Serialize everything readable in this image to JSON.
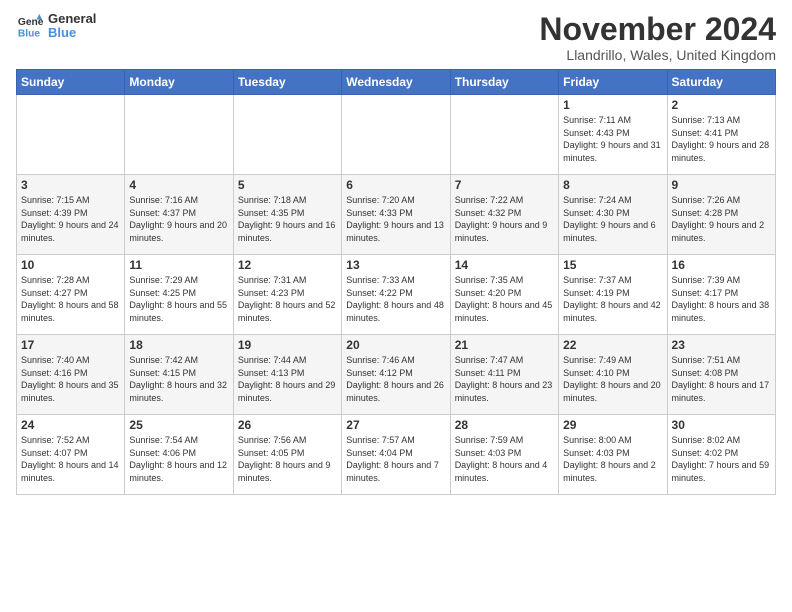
{
  "header": {
    "logo_line1": "General",
    "logo_line2": "Blue",
    "title": "November 2024",
    "location": "Llandrillo, Wales, United Kingdom"
  },
  "days_of_week": [
    "Sunday",
    "Monday",
    "Tuesday",
    "Wednesday",
    "Thursday",
    "Friday",
    "Saturday"
  ],
  "weeks": [
    [
      {
        "day": "",
        "info": ""
      },
      {
        "day": "",
        "info": ""
      },
      {
        "day": "",
        "info": ""
      },
      {
        "day": "",
        "info": ""
      },
      {
        "day": "",
        "info": ""
      },
      {
        "day": "1",
        "info": "Sunrise: 7:11 AM\nSunset: 4:43 PM\nDaylight: 9 hours and 31 minutes."
      },
      {
        "day": "2",
        "info": "Sunrise: 7:13 AM\nSunset: 4:41 PM\nDaylight: 9 hours and 28 minutes."
      }
    ],
    [
      {
        "day": "3",
        "info": "Sunrise: 7:15 AM\nSunset: 4:39 PM\nDaylight: 9 hours and 24 minutes."
      },
      {
        "day": "4",
        "info": "Sunrise: 7:16 AM\nSunset: 4:37 PM\nDaylight: 9 hours and 20 minutes."
      },
      {
        "day": "5",
        "info": "Sunrise: 7:18 AM\nSunset: 4:35 PM\nDaylight: 9 hours and 16 minutes."
      },
      {
        "day": "6",
        "info": "Sunrise: 7:20 AM\nSunset: 4:33 PM\nDaylight: 9 hours and 13 minutes."
      },
      {
        "day": "7",
        "info": "Sunrise: 7:22 AM\nSunset: 4:32 PM\nDaylight: 9 hours and 9 minutes."
      },
      {
        "day": "8",
        "info": "Sunrise: 7:24 AM\nSunset: 4:30 PM\nDaylight: 9 hours and 6 minutes."
      },
      {
        "day": "9",
        "info": "Sunrise: 7:26 AM\nSunset: 4:28 PM\nDaylight: 9 hours and 2 minutes."
      }
    ],
    [
      {
        "day": "10",
        "info": "Sunrise: 7:28 AM\nSunset: 4:27 PM\nDaylight: 8 hours and 58 minutes."
      },
      {
        "day": "11",
        "info": "Sunrise: 7:29 AM\nSunset: 4:25 PM\nDaylight: 8 hours and 55 minutes."
      },
      {
        "day": "12",
        "info": "Sunrise: 7:31 AM\nSunset: 4:23 PM\nDaylight: 8 hours and 52 minutes."
      },
      {
        "day": "13",
        "info": "Sunrise: 7:33 AM\nSunset: 4:22 PM\nDaylight: 8 hours and 48 minutes."
      },
      {
        "day": "14",
        "info": "Sunrise: 7:35 AM\nSunset: 4:20 PM\nDaylight: 8 hours and 45 minutes."
      },
      {
        "day": "15",
        "info": "Sunrise: 7:37 AM\nSunset: 4:19 PM\nDaylight: 8 hours and 42 minutes."
      },
      {
        "day": "16",
        "info": "Sunrise: 7:39 AM\nSunset: 4:17 PM\nDaylight: 8 hours and 38 minutes."
      }
    ],
    [
      {
        "day": "17",
        "info": "Sunrise: 7:40 AM\nSunset: 4:16 PM\nDaylight: 8 hours and 35 minutes."
      },
      {
        "day": "18",
        "info": "Sunrise: 7:42 AM\nSunset: 4:15 PM\nDaylight: 8 hours and 32 minutes."
      },
      {
        "day": "19",
        "info": "Sunrise: 7:44 AM\nSunset: 4:13 PM\nDaylight: 8 hours and 29 minutes."
      },
      {
        "day": "20",
        "info": "Sunrise: 7:46 AM\nSunset: 4:12 PM\nDaylight: 8 hours and 26 minutes."
      },
      {
        "day": "21",
        "info": "Sunrise: 7:47 AM\nSunset: 4:11 PM\nDaylight: 8 hours and 23 minutes."
      },
      {
        "day": "22",
        "info": "Sunrise: 7:49 AM\nSunset: 4:10 PM\nDaylight: 8 hours and 20 minutes."
      },
      {
        "day": "23",
        "info": "Sunrise: 7:51 AM\nSunset: 4:08 PM\nDaylight: 8 hours and 17 minutes."
      }
    ],
    [
      {
        "day": "24",
        "info": "Sunrise: 7:52 AM\nSunset: 4:07 PM\nDaylight: 8 hours and 14 minutes."
      },
      {
        "day": "25",
        "info": "Sunrise: 7:54 AM\nSunset: 4:06 PM\nDaylight: 8 hours and 12 minutes."
      },
      {
        "day": "26",
        "info": "Sunrise: 7:56 AM\nSunset: 4:05 PM\nDaylight: 8 hours and 9 minutes."
      },
      {
        "day": "27",
        "info": "Sunrise: 7:57 AM\nSunset: 4:04 PM\nDaylight: 8 hours and 7 minutes."
      },
      {
        "day": "28",
        "info": "Sunrise: 7:59 AM\nSunset: 4:03 PM\nDaylight: 8 hours and 4 minutes."
      },
      {
        "day": "29",
        "info": "Sunrise: 8:00 AM\nSunset: 4:03 PM\nDaylight: 8 hours and 2 minutes."
      },
      {
        "day": "30",
        "info": "Sunrise: 8:02 AM\nSunset: 4:02 PM\nDaylight: 7 hours and 59 minutes."
      }
    ]
  ]
}
